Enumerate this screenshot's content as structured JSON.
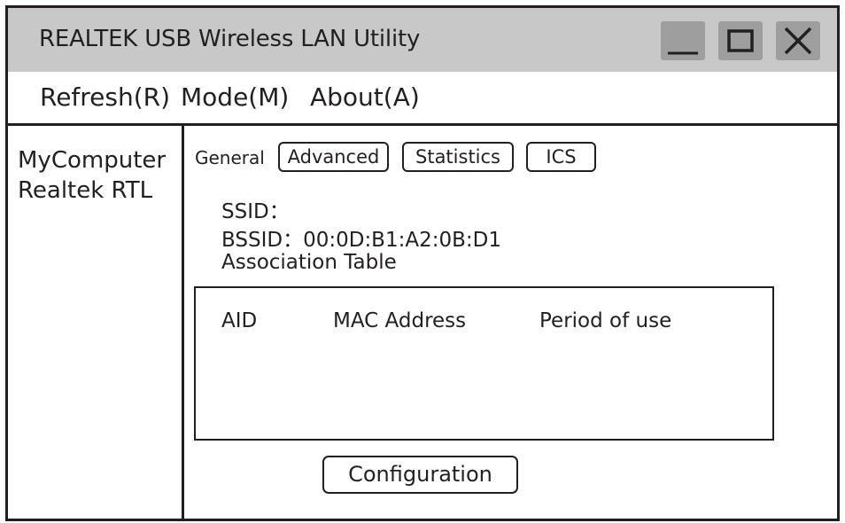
{
  "window": {
    "title": "REALTEK USB Wireless LAN Utility"
  },
  "menu": {
    "items": [
      "Refresh(R)",
      "Mode(M)",
      "About(A)"
    ]
  },
  "sidebar": {
    "items": [
      "MyComputer",
      "Realtek RTL"
    ]
  },
  "tabs": {
    "general": "General",
    "advanced": "Advanced",
    "statistics": "Statistics",
    "ics": "ICS"
  },
  "info": {
    "ssid_label": "SSID：",
    "bssid_label": "BSSID：",
    "bssid_value": "00:0D:B1:A2:0B:D1",
    "association_table": "Association Table"
  },
  "table": {
    "columns": [
      "AID",
      "MAC Address",
      "Period of use"
    ]
  },
  "buttons": {
    "configuration": "Configuration"
  },
  "colors": {
    "titlebar": "#c8c8c8",
    "window_button": "#9e9e9e",
    "stroke": "#231f20"
  }
}
